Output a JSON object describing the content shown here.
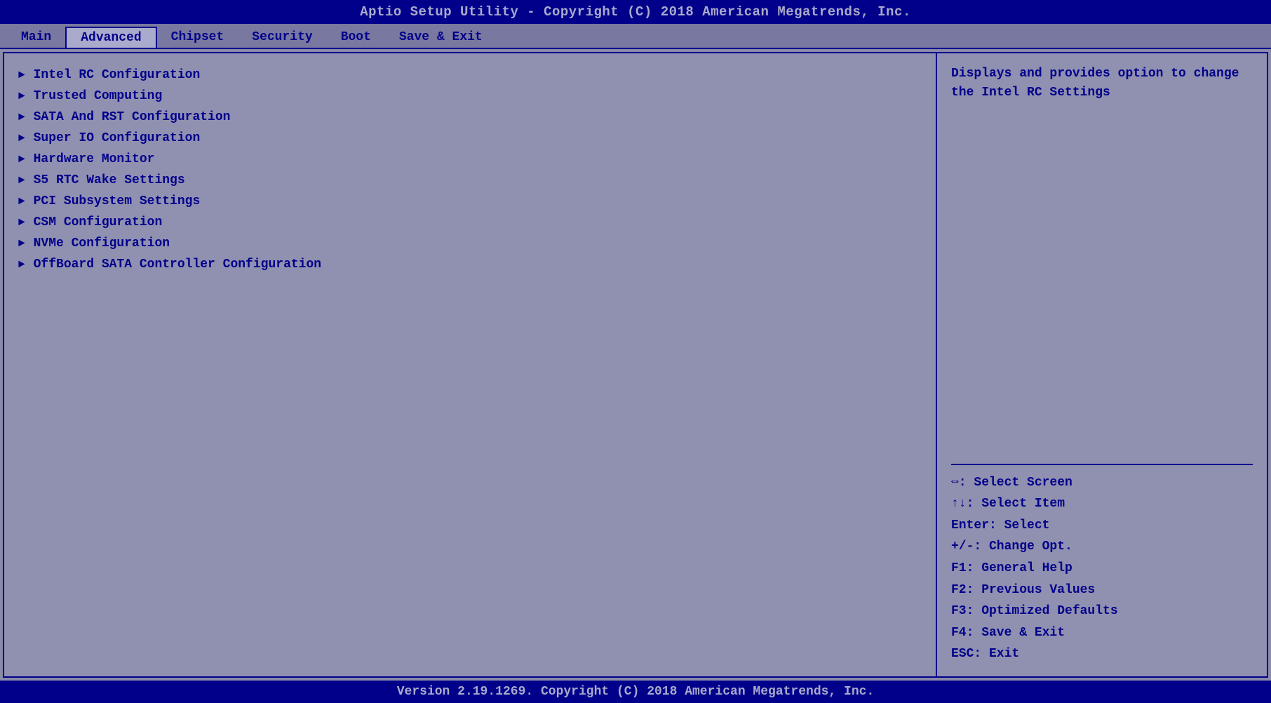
{
  "title": "Aptio Setup Utility - Copyright (C) 2018 American Megatrends, Inc.",
  "nav": {
    "tabs": [
      {
        "label": "Main",
        "active": false
      },
      {
        "label": "Advanced",
        "active": true
      },
      {
        "label": "Chipset",
        "active": false
      },
      {
        "label": "Security",
        "active": false
      },
      {
        "label": "Boot",
        "active": false
      },
      {
        "label": "Save & Exit",
        "active": false
      }
    ]
  },
  "menu": {
    "items": [
      {
        "label": "Intel RC Configuration"
      },
      {
        "label": "Trusted Computing"
      },
      {
        "label": "SATA And RST Configuration"
      },
      {
        "label": "Super IO Configuration"
      },
      {
        "label": "Hardware Monitor"
      },
      {
        "label": "S5 RTC Wake Settings"
      },
      {
        "label": "PCI Subsystem Settings"
      },
      {
        "label": "CSM Configuration"
      },
      {
        "label": "NVMe Configuration"
      },
      {
        "label": "OffBoard SATA Controller Configuration"
      }
    ]
  },
  "help": {
    "description": "Displays and provides option\nto change the Intel RC Settings"
  },
  "keyhelp": {
    "lines": [
      "⇔: Select Screen",
      "↑↓: Select Item",
      "Enter: Select",
      "+/-: Change Opt.",
      "F1: General Help",
      "F2: Previous Values",
      "F3: Optimized Defaults",
      "F4: Save & Exit",
      "ESC: Exit"
    ]
  },
  "footer": "Version 2.19.1269. Copyright (C) 2018 American Megatrends, Inc."
}
